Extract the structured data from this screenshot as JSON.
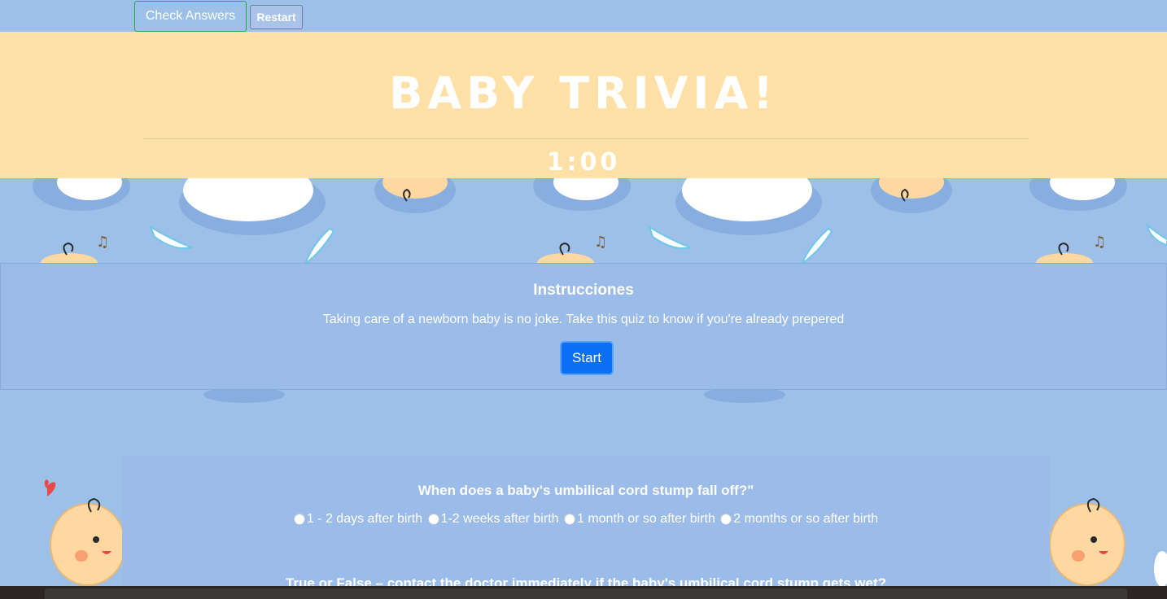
{
  "toolbar": {
    "check_label": "Check Answers",
    "restart_label": "Restart"
  },
  "header": {
    "title": "BABY TRIVIA!",
    "timer": "1:00"
  },
  "instructions": {
    "title": "Instrucciones",
    "text": "Taking care of a newborn baby is no joke. Take this quiz to know if you're already prepered",
    "start_label": "Start"
  },
  "quiz": {
    "questions": [
      {
        "text": "When does a baby's umbilical cord stump fall off?\"",
        "options": [
          "1 - 2 days after birth",
          "1-2 weeks after birth",
          "1 month or so after birth",
          "2 months or so after birth"
        ]
      },
      {
        "text": "True or False – contact the doctor immediately if the baby's umbilical cord stump gets wet?"
      }
    ]
  },
  "colors": {
    "background": "#9dc0e8",
    "banner": "#ffe0a6",
    "check_border": "#28a745",
    "start_button": "#0a6ff5"
  }
}
